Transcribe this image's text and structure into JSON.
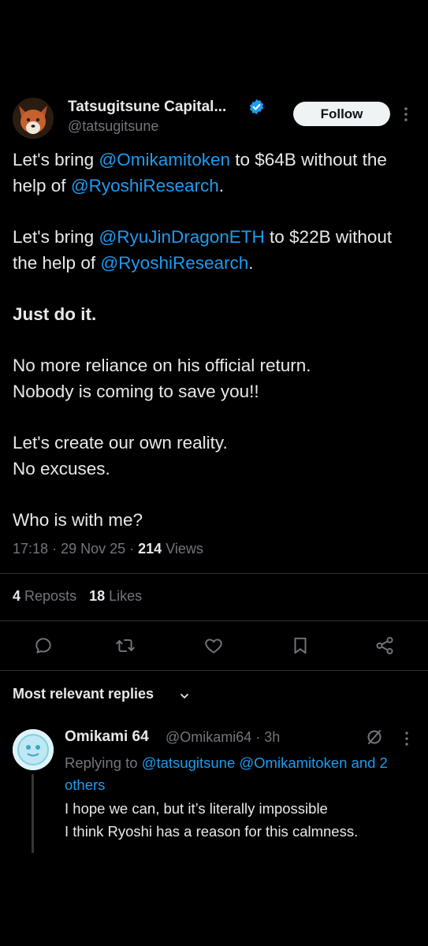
{
  "tweet": {
    "author_name": "Tatsugitsune Capital...",
    "author_handle": "@tatsugitsune",
    "follow_label": "Follow",
    "paragraphs": [
      {
        "bold": false,
        "parts": [
          {
            "text": "Let's bring "
          },
          {
            "text": "@Omikamitoken",
            "mention": true
          },
          {
            "text": " to $64B without the help of "
          },
          {
            "text": "@RyoshiResearch",
            "mention": true
          },
          {
            "text": "."
          }
        ]
      },
      {
        "bold": false,
        "parts": [
          {
            "text": "Let's bring "
          },
          {
            "text": "@RyuJinDragonETH",
            "mention": true
          },
          {
            "text": " to $22B without the help of "
          },
          {
            "text": "@RyoshiResearch",
            "mention": true
          },
          {
            "text": "."
          }
        ]
      },
      {
        "bold": true,
        "parts": [
          {
            "text": "Just do it."
          }
        ]
      },
      {
        "bold": false,
        "lines": [
          "No more reliance on his official return.",
          "Nobody is coming to save you!!"
        ]
      },
      {
        "bold": false,
        "lines": [
          "Let's create our own reality.",
          "No excuses."
        ]
      },
      {
        "bold": false,
        "parts": [
          {
            "text": "Who is with me?"
          }
        ]
      }
    ],
    "time": "17:18",
    "date": "29 Nov 25",
    "views_count": "214",
    "views_label": "Views",
    "reposts_count": "4",
    "reposts_label": "Reposts",
    "likes_count": "18",
    "likes_label": "Likes"
  },
  "replies": {
    "header": "Most relevant replies",
    "items": [
      {
        "name": "Omikami 64",
        "handle": "@Omikami64",
        "time": "3h",
        "replying_prefix": "Replying to ",
        "replying_to": [
          "@tatsugitsune",
          "@Omikamitoken"
        ],
        "others": "and 2 others",
        "text_lines": [
          "I hope we can, but it’s literally impossible",
          "I think Ryoshi has a reason for this calmness."
        ]
      }
    ]
  },
  "colors": {
    "background": "#000000",
    "text": "#e7e9ea",
    "muted": "#71767b",
    "accent": "#1d9bf0",
    "divider": "#2f3336"
  },
  "icons": [
    "verified-badge-icon",
    "more-vertical-icon",
    "reply-icon",
    "repost-icon",
    "like-icon",
    "bookmark-icon",
    "share-icon",
    "chevron-down-icon",
    "grok-icon"
  ]
}
